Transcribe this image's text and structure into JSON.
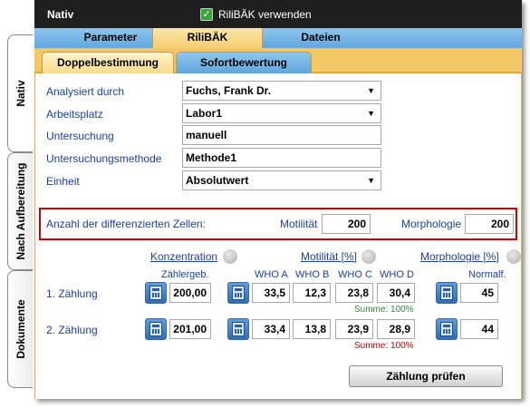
{
  "side_tabs": [
    {
      "label": "Nativ"
    },
    {
      "label": "Nach Aufbereitung"
    },
    {
      "label": "Dokumente"
    }
  ],
  "window": {
    "title": "Nativ",
    "rilibaek_label": "RiliBÄK verwenden",
    "rilibaek_checked": true
  },
  "tabs": [
    {
      "label": "Parameter"
    },
    {
      "label": "RiliBÄK"
    },
    {
      "label": "Dateien"
    }
  ],
  "subtabs": [
    {
      "label": "Doppelbestimmung"
    },
    {
      "label": "Sofortbewertung"
    }
  ],
  "form": {
    "analysiert_label": "Analysiert durch",
    "analysiert_value": "Fuchs, Frank Dr.",
    "arbeitsplatz_label": "Arbeitsplatz",
    "arbeitsplatz_value": "Labor1",
    "untersuchung_label": "Untersuchung",
    "untersuchung_value": "manuell",
    "methode_label": "Untersuchungsmethode",
    "methode_value": "Methode1",
    "einheit_label": "Einheit",
    "einheit_value": "Absolutwert"
  },
  "diff": {
    "label": "Anzahl der differenzierten Zellen:",
    "motilitaet_label": "Motilität",
    "motilitaet_value": "200",
    "morphologie_label": "Morphologie",
    "morphologie_value": "200"
  },
  "counts": {
    "konz_header": "Konzentration",
    "motil_header": "Motilität [%]",
    "morph_header": "Morphologie [%]",
    "zaehlergeb": "Zählergeb.",
    "who_a": "WHO A",
    "who_b": "WHO B",
    "who_c": "WHO C",
    "who_d": "WHO  D",
    "normalf": "Normalf.",
    "row1": {
      "label": "1. Zählung",
      "konz": "200,00",
      "a": "33,5",
      "b": "12,3",
      "c": "23,8",
      "d": "30,4",
      "sum": "Summe: 100%",
      "norm": "45"
    },
    "row2": {
      "label": "2. Zählung",
      "konz": "201,00",
      "a": "33,4",
      "b": "13,8",
      "c": "23,9",
      "d": "28,9",
      "sum": "Summe: 100%",
      "norm": "44"
    }
  },
  "button": {
    "label": "Zählung prüfen"
  },
  "colors": {
    "sum_ok": "#2e8b2e",
    "sum_bad": "#d10000",
    "label_blue": "#1a3fa6"
  }
}
